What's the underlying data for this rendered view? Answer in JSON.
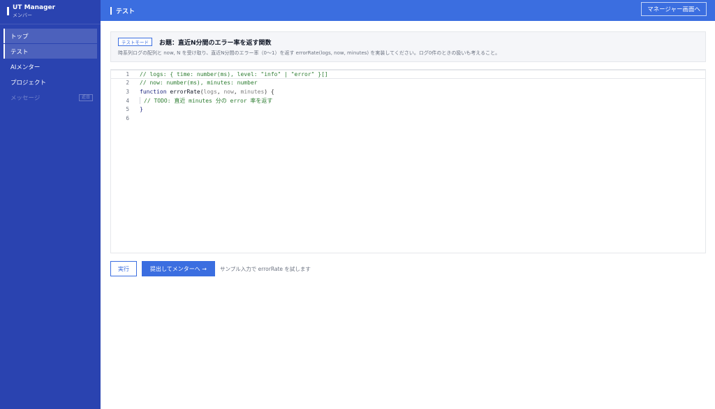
{
  "app": {
    "title": "UT Manager",
    "role": "メンバー"
  },
  "sidebar": {
    "items": [
      {
        "label": "トップ"
      },
      {
        "label": "テスト"
      },
      {
        "label": "AIメンター"
      },
      {
        "label": "プロジェクト"
      },
      {
        "label": "メッセージ",
        "badge": "近日"
      }
    ]
  },
  "header": {
    "title": "テスト",
    "manager_button": "マネージャー画面へ"
  },
  "task": {
    "mode_tag": "テストモード",
    "title": "お題：直近N分間のエラー率を返す関数",
    "description": "時系列ログの配列と now, N を受け取り、直近N分間のエラー率（0〜1）を返す errorRate(logs, now, minutes) を実装してください。ログ0件のときの扱いも考えること。"
  },
  "editor": {
    "line_numbers": [
      "1",
      "2",
      "3",
      "4",
      "5",
      "6"
    ],
    "line1": "// logs: { time: number(ms), level: \"info\" | \"error\" }[]",
    "line2": "// now: number(ms), minutes: number",
    "line3_kw": "function",
    "line3_fn": "errorRate",
    "line3_p1": "logs",
    "line3_p2": "now",
    "line3_p3": "minutes",
    "line4": "// TODO: 直近 minutes 分の error 率を返す",
    "line5": "}"
  },
  "actions": {
    "run": "実行",
    "submit": "提出してメンターへ →",
    "hint": "サンプル入力で errorRate を試します"
  }
}
